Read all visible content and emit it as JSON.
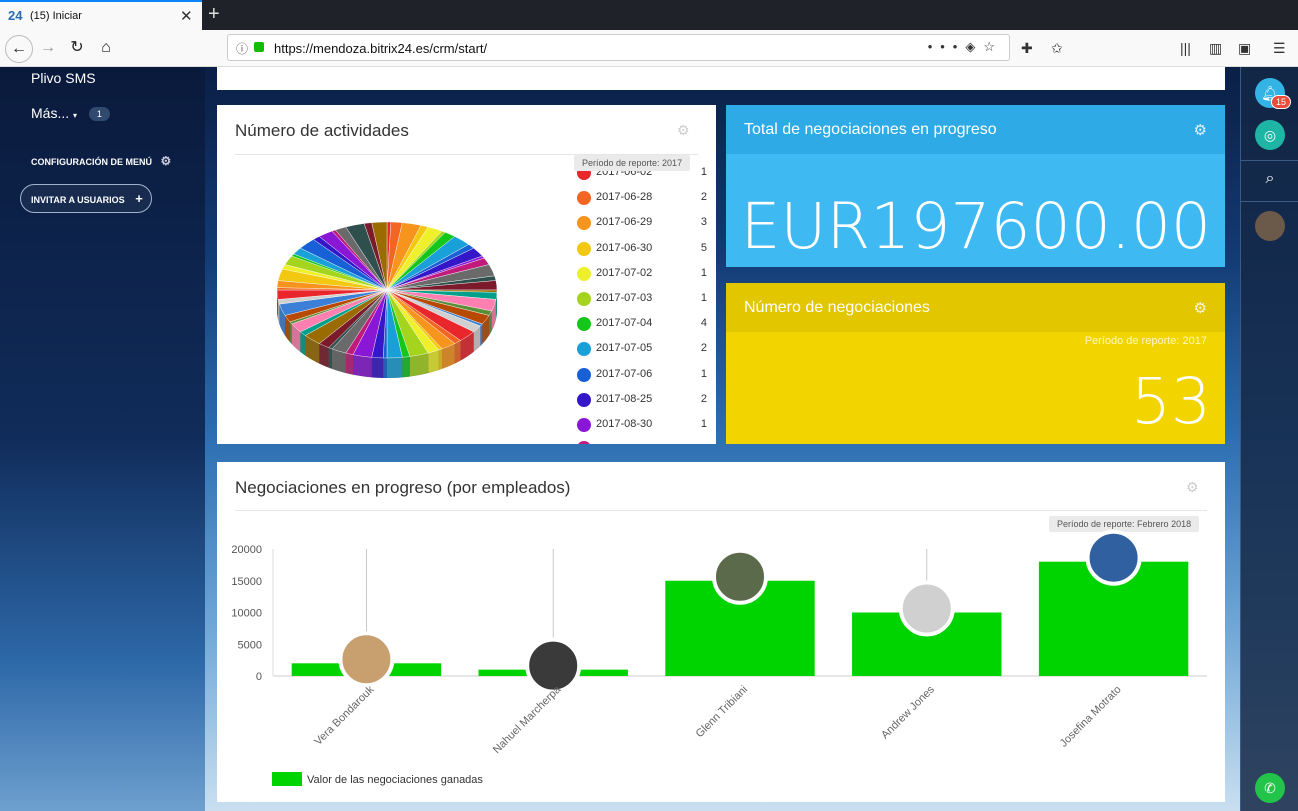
{
  "browser": {
    "tab_logo": "24",
    "tab_title": "(15) Iniciar",
    "url": "https://mendoza.bitrix24.es/crm/start/"
  },
  "sidebar": {
    "items": [
      {
        "label": "Plivo SMS"
      },
      {
        "label": "Más..."
      }
    ],
    "more_badge": "1",
    "menu_config_label": "CONFIGURACIÓN DE MENÚ",
    "invite_label": "INVITAR A USUARIOS"
  },
  "rightbar": {
    "notifications_count": "15"
  },
  "activities_card": {
    "title": "Número de actividades",
    "period": "Período de reporte: 2017",
    "legend": [
      {
        "date": "2017-06-02",
        "count": "1",
        "color": "#e8262c"
      },
      {
        "date": "2017-06-28",
        "count": "2",
        "color": "#f26522"
      },
      {
        "date": "2017-06-29",
        "count": "3",
        "color": "#f7941d"
      },
      {
        "date": "2017-06-30",
        "count": "5",
        "color": "#f2c811"
      },
      {
        "date": "2017-07-02",
        "count": "1",
        "color": "#eef02b"
      },
      {
        "date": "2017-07-03",
        "count": "1",
        "color": "#a4d41c"
      },
      {
        "date": "2017-07-04",
        "count": "4",
        "color": "#14c71a"
      },
      {
        "date": "2017-07-05",
        "count": "2",
        "color": "#1aa0d8"
      },
      {
        "date": "2017-07-06",
        "count": "1",
        "color": "#1760d6"
      },
      {
        "date": "2017-08-25",
        "count": "2",
        "color": "#3417c9"
      },
      {
        "date": "2017-08-30",
        "count": "1",
        "color": "#8a17d6"
      }
    ]
  },
  "total_card": {
    "title": "Total de negociaciones en progreso",
    "value": "EUR197600.00",
    "color": "#3fb9f2"
  },
  "count_card": {
    "title": "Número de negociaciones",
    "period": "Período de reporte: 2017",
    "value": "53",
    "color": "#f2d400"
  },
  "deals_card": {
    "title": "Negociaciones en progreso (por empleados)",
    "period": "Período de reporte: Febrero 2018"
  },
  "chart_data": {
    "type": "bar",
    "categories": [
      "Vera Bondarouk",
      "Nahuel Marcherpa",
      "Glenn Tribiani",
      "Andrew Jones",
      "Josefina Motrato"
    ],
    "series": [
      {
        "name": "Valor de las negociaciones ganadas",
        "values": [
          2000,
          1000,
          15000,
          10000,
          18000
        ],
        "color": "#00d400"
      }
    ],
    "y_ticks": [
      "20000",
      "15000",
      "10000",
      "5000",
      "0"
    ],
    "ylim": [
      0,
      20000
    ],
    "legend_position": "bottom-left"
  }
}
